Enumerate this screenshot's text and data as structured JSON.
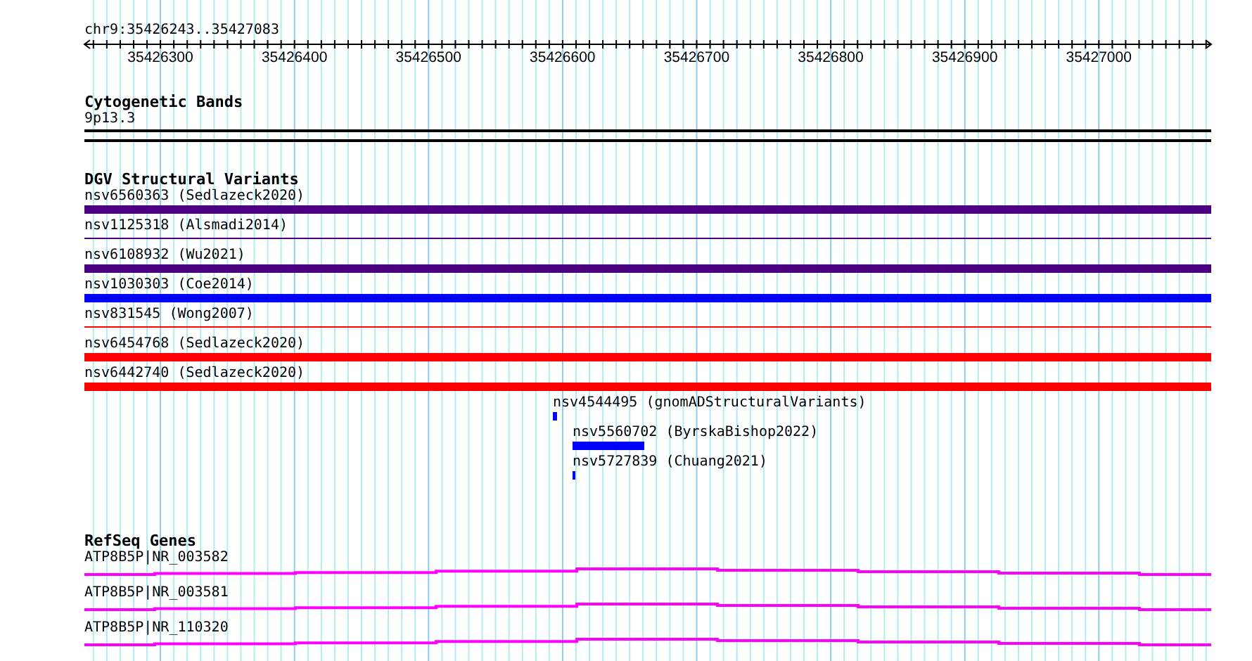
{
  "location": "chr9:35426243..35427083",
  "ruler": {
    "ticks": [
      "35426300",
      "35426400",
      "35426500",
      "35426600",
      "35426700",
      "35426800",
      "35426900",
      "35427000"
    ]
  },
  "tracks": [
    {
      "kind": "bands",
      "title": "Cytogenetic Bands",
      "features": [
        {
          "label": "9p13.3"
        }
      ]
    },
    {
      "kind": "variants",
      "title": "DGV Structural Variants",
      "features": [
        {
          "label": "nsv6560363 (Sedlazeck2020)",
          "color": "#4b0082",
          "kind": "thick"
        },
        {
          "label": "nsv1125318 (Alsmadi2014)",
          "color": "#4b0082",
          "kind": "thin"
        },
        {
          "label": "nsv6108932 (Wu2021)",
          "color": "#4b0082",
          "kind": "thick"
        },
        {
          "label": "nsv1030303 (Coe2014)",
          "color": "#0000ff",
          "kind": "thick"
        },
        {
          "label": "nsv831545 (Wong2007)",
          "color": "#ff0000",
          "kind": "thin"
        },
        {
          "label": "nsv6454768 (Sedlazeck2020)",
          "color": "#ff0000",
          "kind": "thick"
        },
        {
          "label": "nsv6442740 (Sedlazeck2020)",
          "color": "#ff0000",
          "kind": "thick"
        },
        {
          "label": "nsv4544495 (gnomADStructuralVariants)",
          "color": "#0000ff",
          "kind": "thick"
        },
        {
          "label": "nsv5560702 (ByrskaBishop2022)",
          "color": "#0000ff",
          "kind": "thick"
        },
        {
          "label": "nsv5727839 (Chuang2021)",
          "color": "#0000ff",
          "kind": "thick"
        }
      ]
    },
    {
      "kind": "genes",
      "title": "RefSeq Genes",
      "features": [
        {
          "label": "ATP8B5P|NR_003582"
        },
        {
          "label": "ATP8B5P|NR_003581"
        },
        {
          "label": "ATP8B5P|NR_110320"
        }
      ]
    }
  ]
}
